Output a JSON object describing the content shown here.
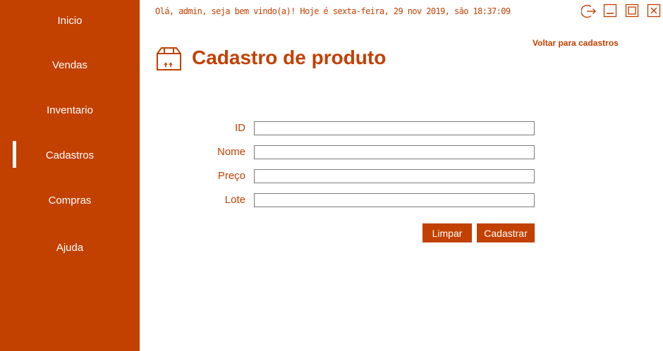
{
  "sidebar": {
    "items": [
      {
        "label": "Inicio"
      },
      {
        "label": "Vendas"
      },
      {
        "label": "Inventario"
      },
      {
        "label": "Cadastros",
        "active": true
      },
      {
        "label": "Compras"
      },
      {
        "label": "Ajuda"
      }
    ]
  },
  "header": {
    "greeting": "Olá, admin, seja bem vindo(a)! Hoje é sexta-feira, 29 nov 2019, são 18:37:09",
    "back_link": "Voltar para cadastros",
    "window_controls": [
      "logout-icon",
      "minimize-icon",
      "maximize-icon",
      "close-icon"
    ]
  },
  "page": {
    "title": "Cadastro de produto",
    "icon": "box-icon"
  },
  "form": {
    "fields": [
      {
        "label": "ID",
        "value": ""
      },
      {
        "label": "Nome",
        "value": ""
      },
      {
        "label": "Preço",
        "value": ""
      },
      {
        "label": "Lote",
        "value": ""
      }
    ],
    "clear_label": "Limpar",
    "submit_label": "Cadastrar"
  },
  "colors": {
    "accent": "#c24000",
    "background": "#ffffff"
  }
}
